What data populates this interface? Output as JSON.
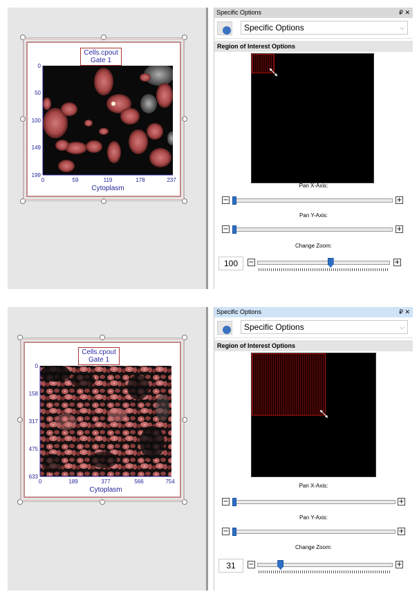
{
  "panel": {
    "title": "Specific Options",
    "pin_glyph": "₽",
    "close_glyph": "✕",
    "selector": "Specific Options",
    "section": "Region of Interest Options",
    "pan_x_label": "Pan X-Axis:",
    "pan_y_label": "Pan Y-Axis:",
    "zoom_label": "Change Zoom:",
    "minus": "−",
    "plus": "+"
  },
  "colors": {
    "axis_text": "#22229a",
    "roi_border": "#a11111",
    "thumb": "#2d6fc4",
    "panel_title_active": "#cfe3f7"
  },
  "views": [
    {
      "gate_line1": "Cells.cpout",
      "gate_line2": "Gate 1",
      "x_title": "Cytoplasm",
      "x_ticks": [
        "0",
        "59",
        "119",
        "178",
        "237"
      ],
      "y_ticks": [
        "0",
        "50",
        "100",
        "149",
        "199"
      ],
      "zoom": "100",
      "zoom_fraction": 0.55,
      "pan_x": 0,
      "pan_y": 0
    },
    {
      "gate_line1": "Cells.cpout",
      "gate_line2": "Gate 1",
      "x_title": "Cytoplasm",
      "x_ticks": [
        "0",
        "189",
        "377",
        "566",
        "754"
      ],
      "y_ticks": [
        "0",
        "158",
        "317",
        "475",
        "633"
      ],
      "zoom": "31",
      "zoom_fraction": 0.17,
      "pan_x": 0,
      "pan_y": 0
    }
  ]
}
